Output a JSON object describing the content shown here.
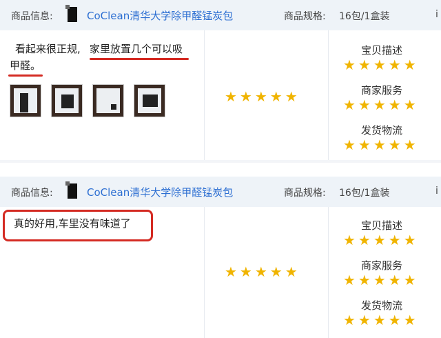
{
  "reviews": [
    {
      "product_info_label": "商品信息:",
      "product_name": "CoClean清华大学除甲醛锰炭包",
      "spec_label": "商品规格:",
      "spec_value": "16包/1盒装",
      "cut_char": "i",
      "text_line1_a": "看起来很正规,",
      "text_line1_b": "家里放置几个可以吸",
      "text_line2": "甲醛。",
      "stars": "★★★★★",
      "ratings": [
        {
          "label": "宝贝描述",
          "stars": "★★★★★"
        },
        {
          "label": "商家服务",
          "stars": "★★★★★"
        },
        {
          "label": "发货物流",
          "stars": "★★★★★"
        }
      ]
    },
    {
      "product_info_label": "商品信息:",
      "product_name": "CoClean清华大学除甲醛锰炭包",
      "spec_label": "商品规格:",
      "spec_value": "16包/1盒装",
      "cut_char": "i",
      "text": "真的好用,车里没有味道了",
      "stars": "★★★★★",
      "ratings": [
        {
          "label": "宝贝描述",
          "stars": "★★★★★"
        },
        {
          "label": "商家服务",
          "stars": "★★★★★"
        },
        {
          "label": "发货物流",
          "stars": "★★★★★"
        }
      ]
    }
  ]
}
